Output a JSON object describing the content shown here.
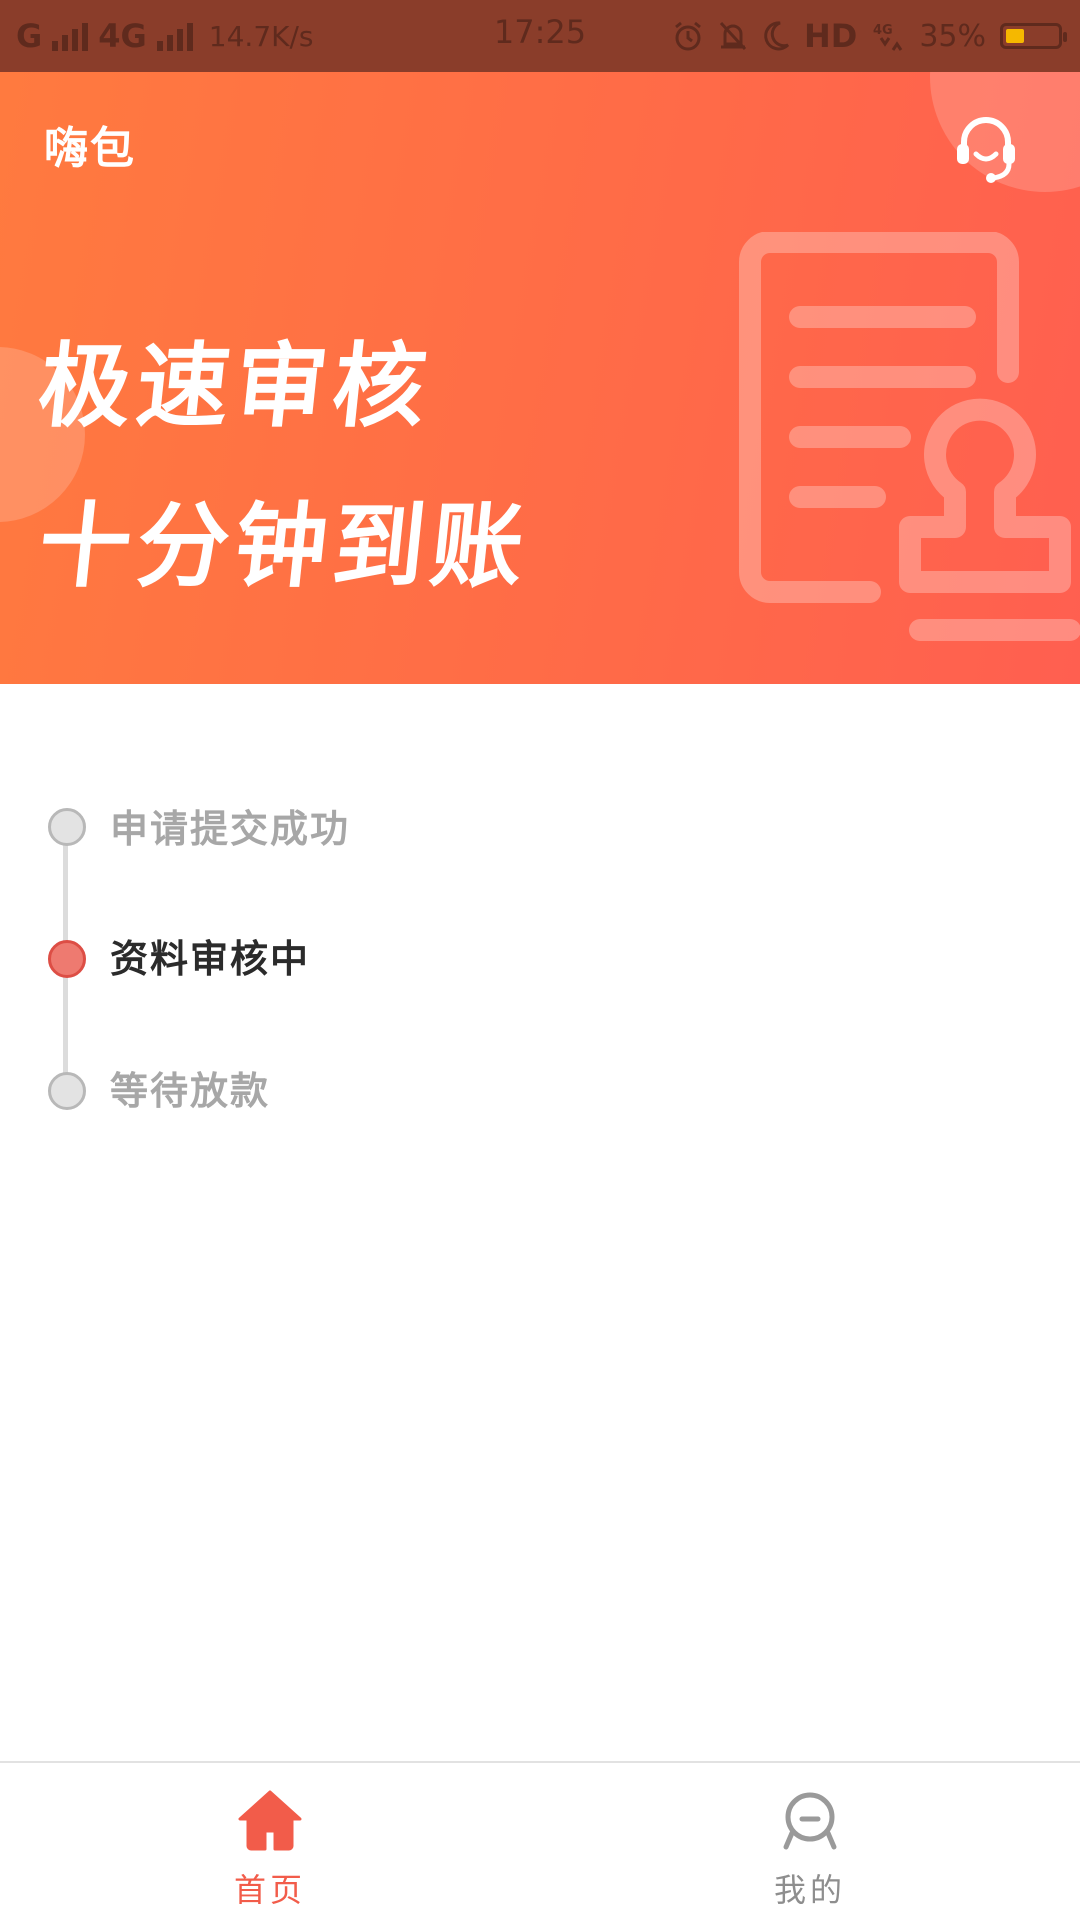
{
  "status_bar": {
    "network_1": "G",
    "network_2": "4G",
    "speed": "14.7K/s",
    "time": "17:25",
    "hd": "HD",
    "battery": "35%",
    "battery_color": "#f5b800"
  },
  "header": {
    "app_title": "嗨包",
    "service_icon": "headset-icon"
  },
  "banner": {
    "slogan_line1": "极速审核",
    "slogan_line2": "十分钟到账",
    "gradient_start": "#ff7a3f",
    "gradient_end": "#ff5f50"
  },
  "progress": {
    "steps": [
      {
        "label": "申请提交成功",
        "state": "inactive"
      },
      {
        "label": "资料审核中",
        "state": "active"
      },
      {
        "label": "等待放款",
        "state": "inactive"
      }
    ],
    "active_color": "#ee7a70"
  },
  "bottom_nav": {
    "items": [
      {
        "label": "首页",
        "icon": "home-icon",
        "selected": true
      },
      {
        "label": "我的",
        "icon": "profile-icon",
        "selected": false
      }
    ],
    "active_color": "#f25c4a"
  }
}
